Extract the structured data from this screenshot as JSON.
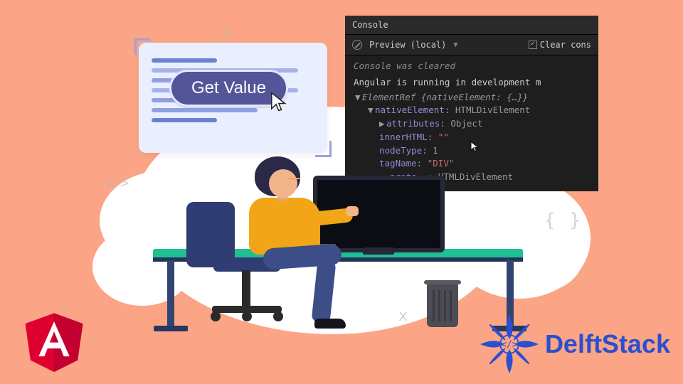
{
  "button": {
    "label": "Get Value"
  },
  "console": {
    "tab": "Console",
    "filter": "Preview (local)",
    "clear_label": "Clear cons",
    "cleared_msg": "Console was cleared",
    "dev_msg": "Angular is running in development m",
    "ref_line": "ElementRef {nativeElement: {…}}",
    "native_label": "nativeElement:",
    "native_type": "HTMLDivElement",
    "attr_label": "attributes:",
    "attr_type": "Object",
    "innerhtml_label": "innerHTML:",
    "innerhtml_val": "\"\"",
    "nodetype_label": "nodeType:",
    "nodetype_val": "1",
    "tagname_label": "tagName:",
    "tagname_val": "\"DIV\"",
    "proto_label": "__proto__:",
    "proto_type": "HTMLDivElement"
  },
  "deco": {
    "x1": "x",
    "x2": ":",
    "tag": "</>",
    "braces": "{ }",
    "x3": "x"
  },
  "brand": {
    "delft": "DelftStack"
  }
}
